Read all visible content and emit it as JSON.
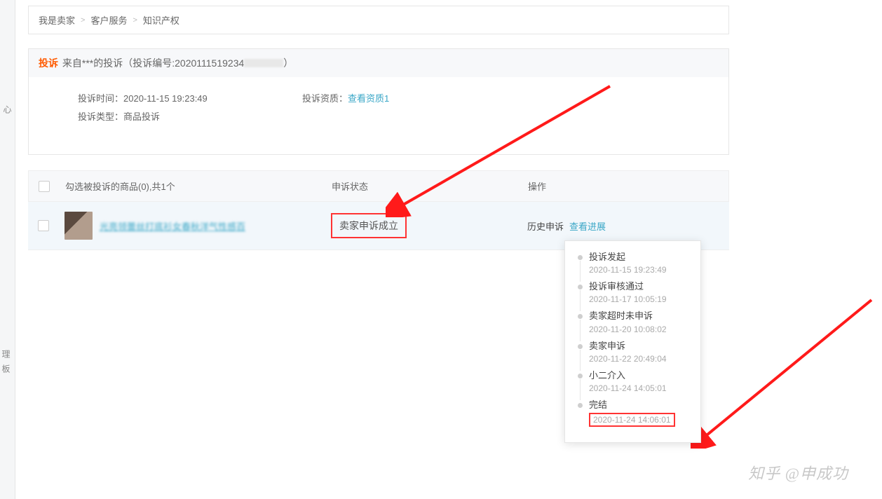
{
  "sidebar": {
    "top_frag": "心",
    "items": [
      "理",
      "板"
    ]
  },
  "breadcrumb": [
    "我是卖家",
    "客户服务",
    "知识产权"
  ],
  "complaint": {
    "tag": "投诉",
    "title_before": "来自***的投诉（投诉编号:",
    "title_num_visible": "2020111519234",
    "title_after": "）",
    "time_label": "投诉时间：",
    "time_value": "2020-11-15 19:23:49",
    "qual_label": "投诉资质：",
    "qual_link": "查看资质1",
    "type_label": "投诉类型：",
    "type_value": "商品投诉"
  },
  "table": {
    "header": {
      "goods": "勾选被投诉的商品(0),共1个",
      "status": "申诉状态",
      "action": "操作"
    },
    "row": {
      "product_title": "光亮领蕾丝打底衫女春秋洋气性感百",
      "status": "卖家申诉成立",
      "history_label": "历史申诉",
      "progress_link": "查看进展"
    }
  },
  "timeline": [
    {
      "title": "投诉发起",
      "time": "2020-11-15 19:23:49"
    },
    {
      "title": "投诉审核通过",
      "time": "2020-11-17 10:05:19"
    },
    {
      "title": "卖家超时未申诉",
      "time": "2020-11-20 10:08:02"
    },
    {
      "title": "卖家申诉",
      "time": "2020-11-22 20:49:04"
    },
    {
      "title": "小二介入",
      "time": "2020-11-24 14:05:01"
    },
    {
      "title": "完结",
      "time": "2020-11-24 14:06:01",
      "boxed": true
    }
  ],
  "watermark": "知乎 @申成功"
}
